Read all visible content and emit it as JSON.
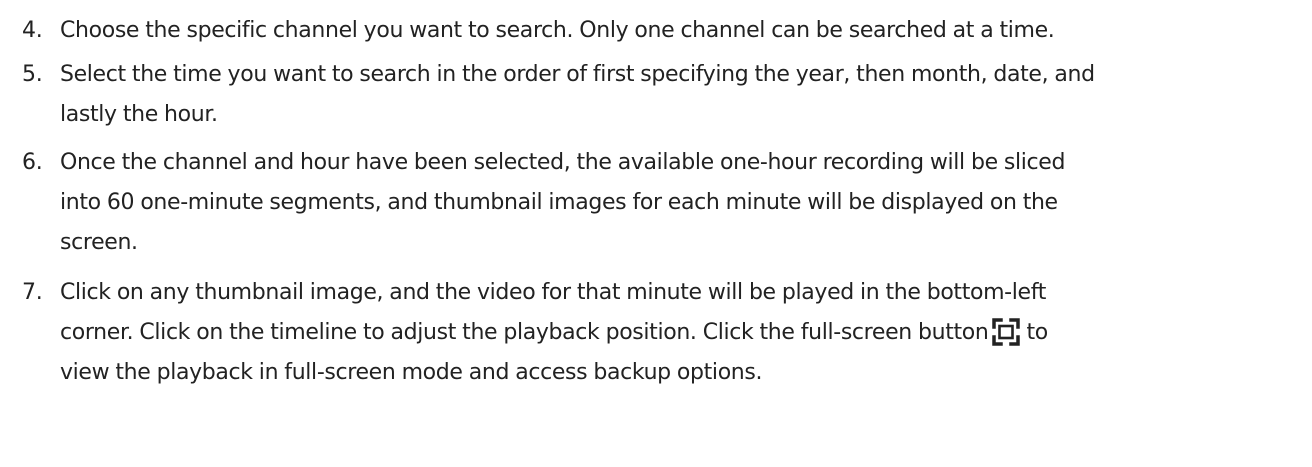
{
  "steps": [
    {
      "number": "4.",
      "lines": [
        "Choose the specific channel you want to search. Only one channel can be searched at a time."
      ]
    },
    {
      "number": "5.",
      "lines": [
        "Select the time you want to search in the order of first specifying the year, then month, date, and",
        "lastly the hour."
      ]
    },
    {
      "number": "6.",
      "lines": [
        "Once the channel and hour have been selected, the available one-hour recording will be sliced",
        "into 60 one-minute segments, and thumbnail images for each minute will be displayed on the",
        "screen."
      ]
    },
    {
      "number": "7.",
      "lines": [
        "Click on any thumbnail image, and the video for that minute will be played in the bottom-left",
        "corner. Click on the timeline to adjust the playback position. Click the full-screen button",
        "view the playback in full-screen mode and access backup options."
      ],
      "after_icon": "to",
      "icon": "fullscreen-icon"
    }
  ]
}
